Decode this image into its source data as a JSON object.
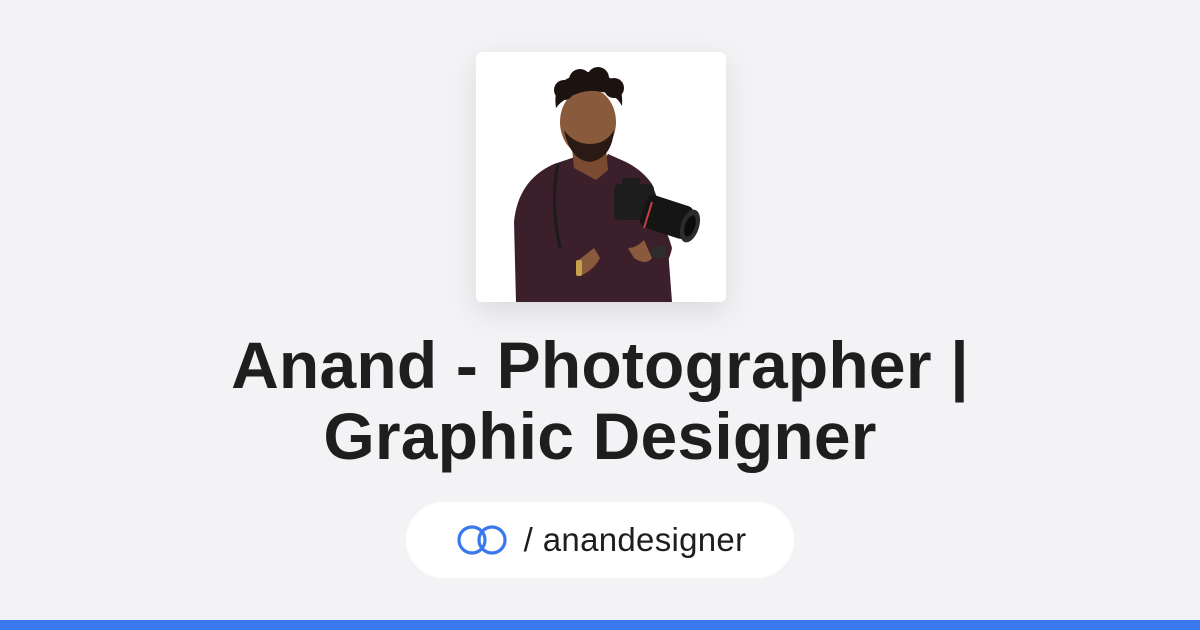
{
  "profile": {
    "title_line1": "Anand - Photographer |",
    "title_line2": "Graphic Designer",
    "separator": "/",
    "handle": "anandesigner",
    "avatar_alt": "Anand holding a camera"
  },
  "icons": {
    "link_icon": "linked-rings-icon"
  },
  "colors": {
    "background": "#f3f3f5",
    "text": "#1e1e1e",
    "accent": "#3a78ee",
    "card": "#ffffff"
  }
}
